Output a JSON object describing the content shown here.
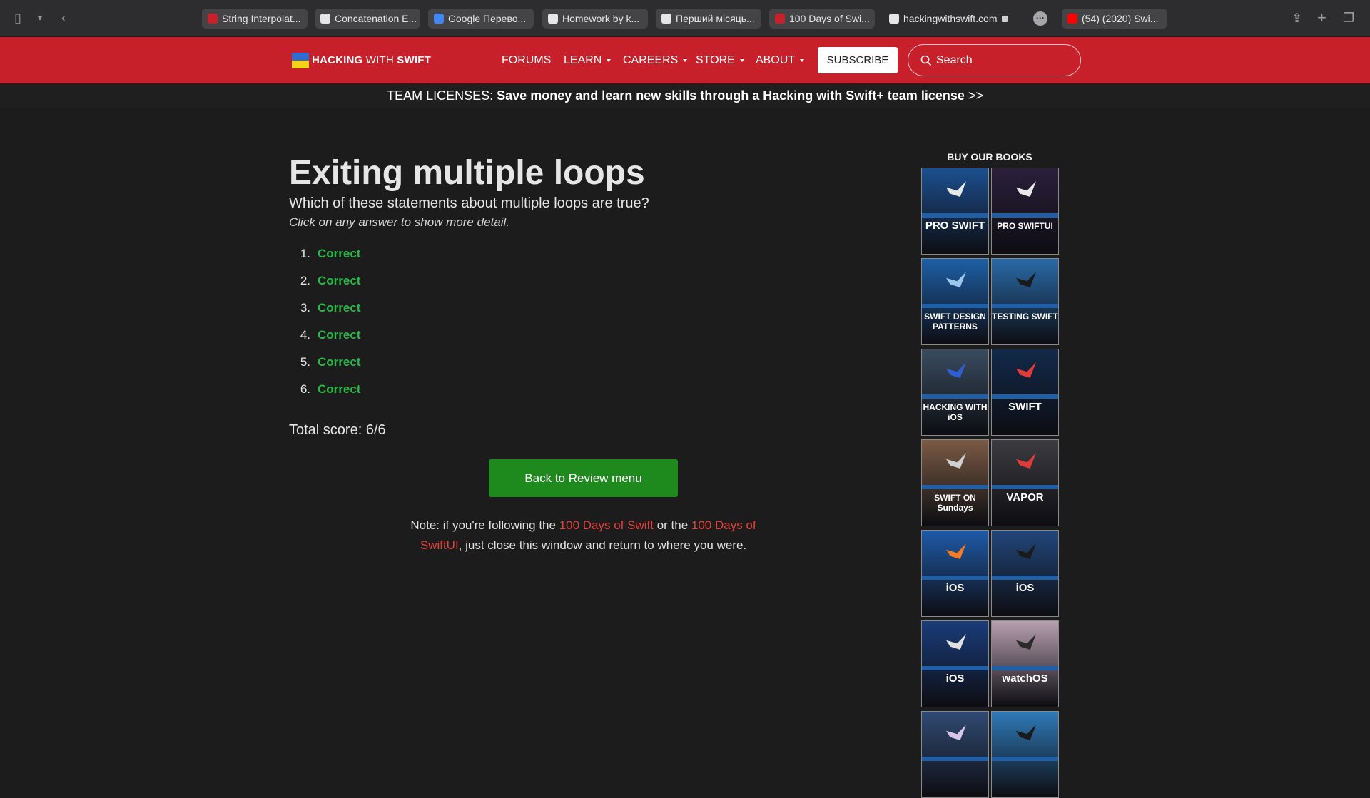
{
  "browser": {
    "tabs": [
      {
        "label": "String Interpolat...",
        "favicon_color": "#c8202a"
      },
      {
        "label": "Concatenation E...",
        "favicon_color": "#e6e6e6"
      },
      {
        "label": "Google Перево...",
        "favicon_color": "#4285f4"
      },
      {
        "label": "Homework by k...",
        "favicon_color": "#e6e6e6"
      },
      {
        "label": "Перший місяць...",
        "favicon_color": "#e6e6e6"
      },
      {
        "label": "100 Days of Swi...",
        "favicon_color": "#c8202a"
      },
      {
        "label": "hackingwithswift.com",
        "favicon_color": "#e6e6e6"
      },
      {
        "label": "(54) (2020) Swi...",
        "favicon_color": "#ff0000"
      }
    ]
  },
  "site": {
    "logo_hacking": "HACKING",
    "logo_with": "WITH",
    "logo_swift": "SWIFT",
    "nav": [
      "FORUMS",
      "LEARN",
      "CAREERS",
      "STORE",
      "ABOUT"
    ],
    "subscribe": "SUBSCRIBE",
    "search_placeholder": "Search",
    "accent": "#c8202a"
  },
  "banner": {
    "prefix": "TEAM LICENSES: ",
    "text": "Save money and learn new skills through a Hacking with Swift+ team license",
    "suffix": " >>"
  },
  "main": {
    "title": "Exiting multiple loops",
    "question": "Which of these statements about multiple loops are true?",
    "hint": "Click on any answer to show more detail.",
    "answers": [
      {
        "num": "1.",
        "status": "Correct"
      },
      {
        "num": "2.",
        "status": "Correct"
      },
      {
        "num": "3.",
        "status": "Correct"
      },
      {
        "num": "4.",
        "status": "Correct"
      },
      {
        "num": "5.",
        "status": "Correct"
      },
      {
        "num": "6.",
        "status": "Correct"
      }
    ],
    "score": "Total score: 6/6",
    "back_button": "Back to Review menu",
    "note_1": "Note: if you're following the ",
    "note_link_1": "100 Days of Swift",
    "note_2": " or the ",
    "note_link_2": "100 Days of SwiftUI",
    "note_3": ", just close this window and return to where you were."
  },
  "sidebar": {
    "heading": "BUY OUR BOOKS",
    "books": [
      {
        "title": "PRO SWIFT",
        "bg": "#1c4f8f",
        "bird": "#e8e8e8"
      },
      {
        "title": "PRO SWIFTUI",
        "bg": "#2a1f3a",
        "bird": "#e8e8e8"
      },
      {
        "title": "SWIFT DESIGN PATTERNS",
        "bg": "#1d5fa6",
        "bird": "#9ec6ec"
      },
      {
        "title": "TESTING SWIFT",
        "bg": "#2a6aa8",
        "bird": "#1a1a1a"
      },
      {
        "title": "HACKING WITH iOS",
        "bg": "#3a4c60",
        "bird": "#2f5fd0"
      },
      {
        "title": "SWIFT",
        "bg": "#12294a",
        "bird": "#e03b3b"
      },
      {
        "title": "SWIFT ON Sundays",
        "bg": "#7a5a44",
        "bird": "#cfcfcf"
      },
      {
        "title": "VAPOR",
        "bg": "#3c3c40",
        "bird": "#e03b3b"
      },
      {
        "title": "iOS",
        "bg": "#1f5aa8",
        "bird": "#f07a2a"
      },
      {
        "title": "iOS",
        "bg": "#22467a",
        "bird": "#1a1a1a"
      },
      {
        "title": "iOS",
        "bg": "#1a3c7a",
        "bird": "#e0e0e0"
      },
      {
        "title": "watchOS",
        "bg": "#b7a0b0",
        "bird": "#2a2a2a"
      },
      {
        "title": "",
        "bg": "#304a72",
        "bird": "#d8c8e8"
      },
      {
        "title": "",
        "bg": "#2f7ab8",
        "bird": "#1a1a1a"
      }
    ]
  }
}
